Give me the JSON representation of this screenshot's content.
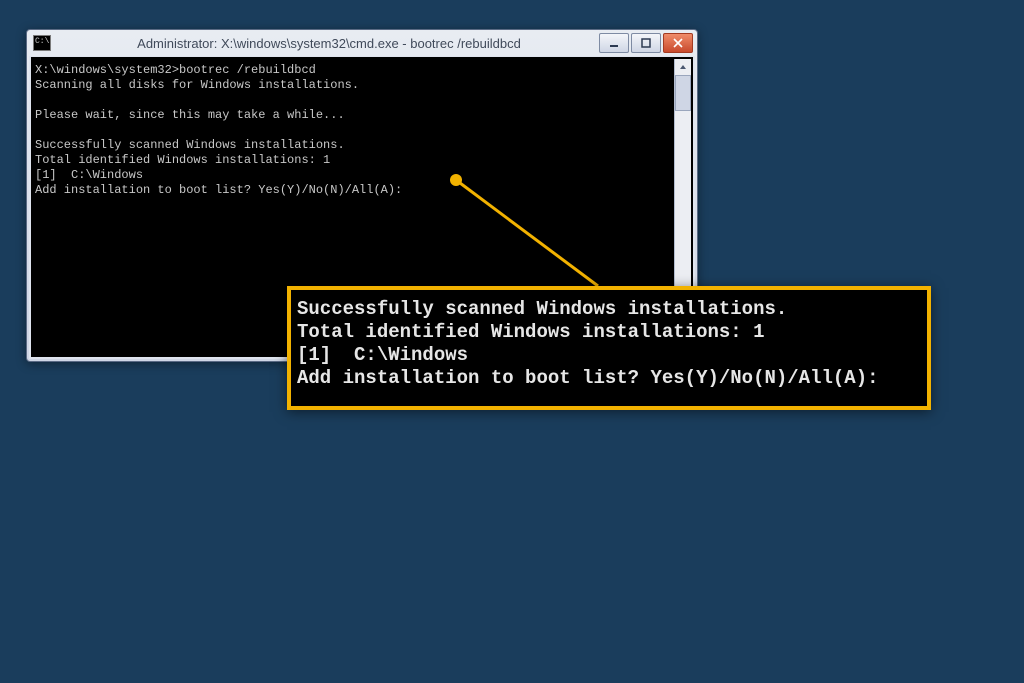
{
  "window": {
    "title": "Administrator: X:\\windows\\system32\\cmd.exe - bootrec  /rebuildbcd"
  },
  "console": {
    "line1": "X:\\windows\\system32>bootrec /rebuildbcd",
    "line2": "Scanning all disks for Windows installations.",
    "line3": "",
    "line4": "Please wait, since this may take a while...",
    "line5": "",
    "line6": "Successfully scanned Windows installations.",
    "line7": "Total identified Windows installations: 1",
    "line8": "[1]  C:\\Windows",
    "line9": "Add installation to boot list? Yes(Y)/No(N)/All(A):"
  },
  "zoom": {
    "line1": "Successfully scanned Windows installations.",
    "line2": "Total identified Windows installations: 1",
    "line3": "[1]  C:\\Windows",
    "line4": "Add installation to boot list? Yes(Y)/No(N)/All(A):"
  },
  "colors": {
    "accent": "#f2b200",
    "desktop": "#1a3d5c"
  }
}
